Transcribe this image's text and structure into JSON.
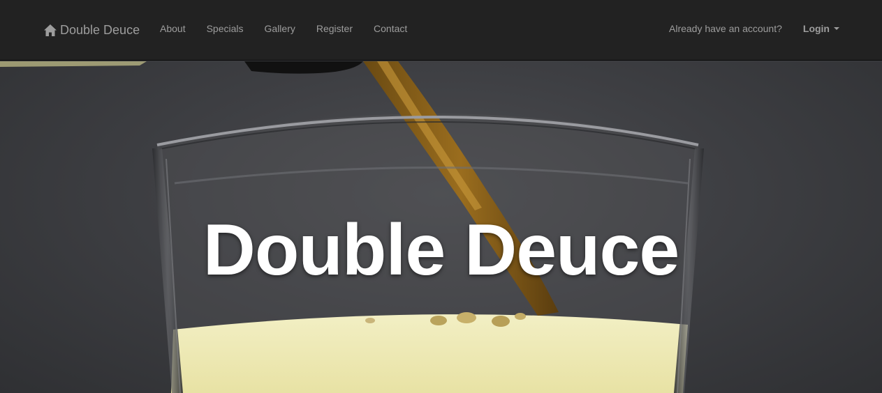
{
  "navbar": {
    "brand": {
      "label": "Double Deuce",
      "icon": "home-icon"
    },
    "links": [
      "About",
      "Specials",
      "Gallery",
      "Register",
      "Contact"
    ],
    "account_prompt": "Already have an account?",
    "login_label": "Login"
  },
  "hero": {
    "title": "Double Deuce",
    "image": "beer-pouring-into-glass"
  },
  "colors": {
    "navbar_bg": "#222222",
    "nav_text": "#9d9d9d",
    "hero_title": "#ffffff"
  }
}
